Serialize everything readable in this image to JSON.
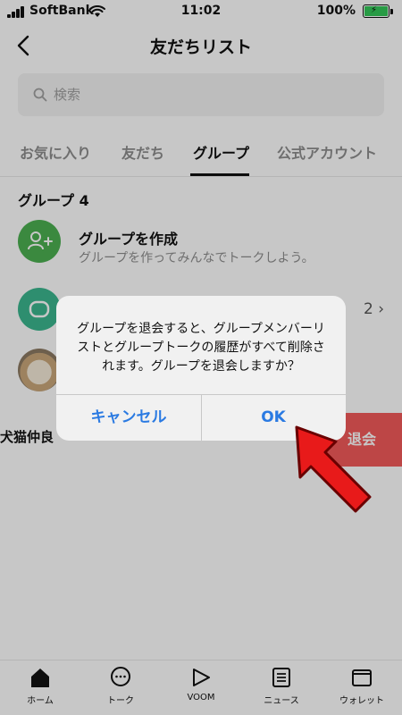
{
  "status_bar": {
    "carrier": "SoftBank",
    "time": "11:02",
    "battery": "100%"
  },
  "header": {
    "title": "友だちリスト"
  },
  "search": {
    "placeholder": "検索"
  },
  "tabs": [
    "お気に入り",
    "友だち",
    "グループ",
    "公式アカウント"
  ],
  "active_tab": "グループ",
  "section": {
    "header": "グループ 4"
  },
  "rows": {
    "create": {
      "title": "グループを作成",
      "subtitle": "グループを作ってみんなでトークしよう。"
    },
    "group1": {
      "count": "2"
    },
    "swiped": {
      "label": "犬猫仲良",
      "leave_label": "退会"
    }
  },
  "dialog": {
    "message": "グループを退会すると、グループメンバーリストとグループトークの履歴がすべて削除されます。グループを退会しますか？",
    "cancel_label": "キャンセル",
    "ok_label": "OK"
  },
  "tabbar": [
    "ホーム",
    "トーク",
    "VOOM",
    "ニュース",
    "ウォレット"
  ],
  "colors": {
    "accent": "#2a7ae2",
    "line_green": "#4cb051",
    "danger": "#f25a5a",
    "arrow": "#e81a1a"
  }
}
